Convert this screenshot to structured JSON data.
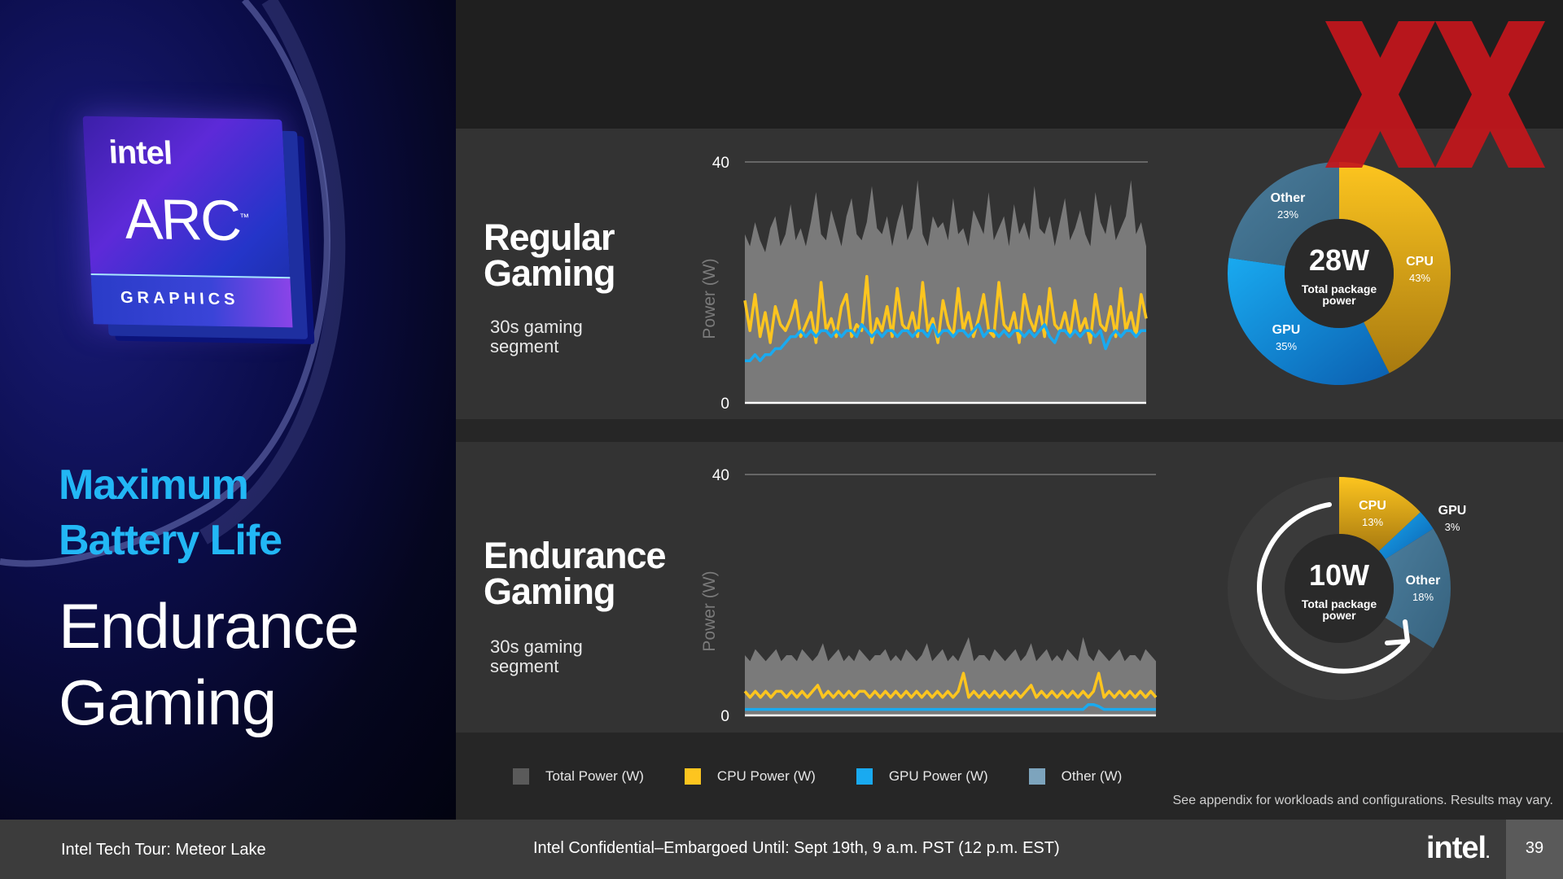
{
  "left": {
    "badge": {
      "brand": "intel",
      "product": "ARC",
      "trademark": "™",
      "label": "GRAPHICS"
    },
    "tagline_line1": "Maximum",
    "tagline_line2": "Battery Life",
    "subtitle_line1": "Endurance",
    "subtitle_line2": "Gaming"
  },
  "rows": [
    {
      "title_line1": "Regular",
      "title_line2": "Gaming",
      "sub_line1": "30s gaming",
      "sub_line2": "segment"
    },
    {
      "title_line1": "Endurance",
      "title_line2": "Gaming",
      "sub_line1": "30s gaming",
      "sub_line2": "segment"
    }
  ],
  "colors": {
    "total": "#7a7a7a",
    "cpu": "#fdc51f",
    "gpu": "#19aaf0",
    "other": "#7da4bd",
    "accent": "#22b7f5"
  },
  "chart_data": [
    {
      "type": "line",
      "ylabel": "Power (W)",
      "ylim": [
        0,
        40
      ],
      "yticks": [
        0,
        40
      ],
      "x_seconds": 30,
      "series": [
        {
          "name": "Total Power (W)",
          "values": [
            28,
            26,
            30,
            27,
            25,
            29,
            31,
            26,
            28,
            33,
            27,
            29,
            26,
            30,
            35,
            28,
            27,
            32,
            29,
            26,
            31,
            34,
            28,
            27,
            30,
            36,
            29,
            28,
            31,
            26,
            30,
            33,
            27,
            29,
            37,
            28,
            26,
            31,
            29,
            30,
            27,
            34,
            28,
            29,
            26,
            32,
            30,
            28,
            35,
            27,
            29,
            31,
            26,
            33,
            28,
            30,
            27,
            36,
            29,
            28,
            31,
            26,
            30,
            34,
            27,
            29,
            32,
            28,
            26,
            35,
            30,
            28,
            33,
            27,
            29,
            31,
            37,
            28,
            30,
            26
          ]
        },
        {
          "name": "CPU Power (W)",
          "values": [
            17,
            12,
            18,
            11,
            15,
            10,
            16,
            13,
            12,
            14,
            17,
            11,
            13,
            15,
            10,
            20,
            12,
            14,
            11,
            16,
            18,
            11,
            13,
            12,
            21,
            10,
            14,
            12,
            16,
            11,
            19,
            13,
            12,
            15,
            11,
            20,
            12,
            14,
            10,
            17,
            13,
            11,
            19,
            12,
            15,
            11,
            14,
            18,
            12,
            11,
            20,
            13,
            12,
            15,
            10,
            18,
            14,
            12,
            16,
            11,
            19,
            13,
            12,
            15,
            11,
            17,
            12,
            14,
            10,
            18,
            13,
            12,
            16,
            11,
            19,
            12,
            15,
            11,
            18,
            14
          ]
        },
        {
          "name": "GPU Power (W)",
          "values": [
            7,
            7,
            8,
            7,
            8,
            8,
            9,
            9,
            10,
            11,
            11,
            12,
            11,
            12,
            11,
            12,
            12,
            11,
            12,
            11,
            12,
            12,
            11,
            13,
            12,
            11,
            12,
            11,
            12,
            12,
            11,
            12,
            12,
            11,
            12,
            12,
            11,
            13,
            11,
            12,
            12,
            11,
            12,
            12,
            11,
            12,
            13,
            11,
            12,
            12,
            11,
            12,
            11,
            12,
            12,
            11,
            12,
            11,
            12,
            13,
            11,
            10,
            12,
            12,
            11,
            12,
            11,
            12,
            12,
            11,
            12,
            9,
            11,
            12,
            11,
            12,
            12,
            11,
            12,
            12
          ]
        }
      ]
    },
    {
      "type": "line",
      "ylabel": "Power (W)",
      "ylim": [
        0,
        40
      ],
      "yticks": [
        0,
        40
      ],
      "x_seconds": 30,
      "series": [
        {
          "name": "Total Power (W)",
          "values": [
            10,
            9,
            11,
            10,
            9,
            10,
            11,
            9,
            10,
            10,
            9,
            11,
            10,
            9,
            10,
            12,
            9,
            10,
            11,
            9,
            10,
            9,
            11,
            10,
            9,
            10,
            10,
            11,
            9,
            10,
            9,
            11,
            10,
            9,
            10,
            12,
            9,
            10,
            11,
            9,
            10,
            9,
            11,
            13,
            9,
            10,
            10,
            9,
            11,
            10,
            9,
            10,
            11,
            9,
            10,
            12,
            9,
            10,
            11,
            9,
            10,
            9,
            11,
            10,
            9,
            13,
            10,
            9,
            11,
            10,
            9,
            10,
            11,
            9,
            10,
            10,
            9,
            11,
            10,
            9
          ]
        },
        {
          "name": "CPU Power (W)",
          "values": [
            4,
            3,
            4,
            3,
            4,
            3,
            4,
            4,
            3,
            4,
            3,
            4,
            3,
            4,
            5,
            3,
            4,
            3,
            4,
            3,
            4,
            3,
            4,
            4,
            3,
            4,
            3,
            4,
            3,
            4,
            3,
            4,
            3,
            4,
            3,
            4,
            3,
            4,
            3,
            4,
            3,
            4,
            7,
            3,
            4,
            3,
            4,
            3,
            4,
            3,
            4,
            3,
            4,
            3,
            4,
            5,
            3,
            4,
            3,
            4,
            3,
            4,
            3,
            4,
            3,
            4,
            3,
            4,
            7,
            3,
            4,
            3,
            4,
            3,
            4,
            3,
            4,
            3,
            4,
            3
          ]
        },
        {
          "name": "GPU Power (W)",
          "values": [
            1,
            1,
            1,
            1,
            1,
            1,
            1,
            1,
            1,
            1,
            1,
            1,
            1,
            1,
            1,
            1,
            1,
            1,
            1,
            1,
            1,
            1,
            1,
            1,
            1,
            1,
            1,
            1,
            1,
            1,
            1,
            1,
            1,
            1,
            1,
            1,
            1,
            1,
            1,
            1,
            1,
            1,
            1,
            1,
            1,
            1,
            1,
            1,
            1,
            1,
            1,
            1,
            1,
            1,
            1,
            1,
            1,
            1,
            1,
            1,
            1,
            1,
            1,
            1,
            1,
            1,
            1.8,
            1.8,
            1.5,
            1,
            1,
            1,
            1,
            1,
            1,
            1,
            1,
            1,
            1,
            1
          ]
        }
      ]
    },
    {
      "type": "pie",
      "center_value": "28W",
      "center_label": "Total package power",
      "slices": [
        {
          "name": "CPU",
          "value": 43,
          "label": "43%"
        },
        {
          "name": "GPU",
          "value": 35,
          "label": "35%"
        },
        {
          "name": "Other",
          "value": 23,
          "label": "23%"
        }
      ]
    },
    {
      "type": "pie",
      "center_value": "10W",
      "center_label": "Total package power",
      "slices": [
        {
          "name": "CPU",
          "value": 13,
          "label": "13%"
        },
        {
          "name": "GPU",
          "value": 3,
          "label": "3%"
        },
        {
          "name": "Other",
          "value": 18,
          "label": "18%"
        }
      ]
    }
  ],
  "legend": [
    {
      "label": "Total Power (W)",
      "color": "#5a5a5a"
    },
    {
      "label": "CPU Power (W)",
      "color": "#fdc51f"
    },
    {
      "label": "GPU Power (W)",
      "color": "#19aaf0"
    },
    {
      "label": "Other  (W)",
      "color": "#7da4bd"
    }
  ],
  "footnote": "See appendix for workloads and configurations. Results may vary.",
  "footer": {
    "left": "Intel Tech Tour:  Meteor Lake",
    "center": "Intel Confidential–Embargoed Until: Sept 19th, 9 a.m. PST (12 p.m. EST)",
    "brand": "intel",
    "brand_dot": ".",
    "page": "39"
  }
}
